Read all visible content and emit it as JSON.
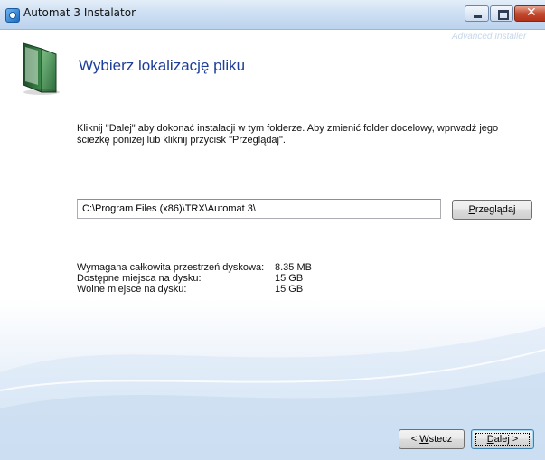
{
  "window": {
    "title": "Automat 3 Instalator",
    "brand": "Advanced Installer"
  },
  "header": {
    "title": "Wybierz lokalizację pliku"
  },
  "instruction": "Kliknij \"Dalej\" aby dokonać instalacji w tym folderze. Aby zmienić folder docelowy, wprwadź jego ścieżkę poniżej lub kliknij przycisk \"Przeglądaj\".",
  "path_field": {
    "value": "C:\\Program Files (x86)\\TRX\\Automat 3\\"
  },
  "buttons": {
    "browse": {
      "prefix": "",
      "mnemonic": "P",
      "rest": "rzeglądaj"
    },
    "back": {
      "prefix": "< ",
      "mnemonic": "W",
      "rest": "stecz"
    },
    "next": {
      "prefix": "",
      "mnemonic": "D",
      "rest": "alej >"
    }
  },
  "disk_info": [
    {
      "label": "Wymagana całkowita przestrzeń dyskowa:",
      "value": "8.35 MB"
    },
    {
      "label": "Dostępne miejsca na dysku:",
      "value": "15 GB"
    },
    {
      "label": "Wolne miejsce na dysku:",
      "value": "15 GB"
    }
  ],
  "colors": {
    "title_blue": "#1e3f99",
    "close_red": "#c24a30"
  }
}
